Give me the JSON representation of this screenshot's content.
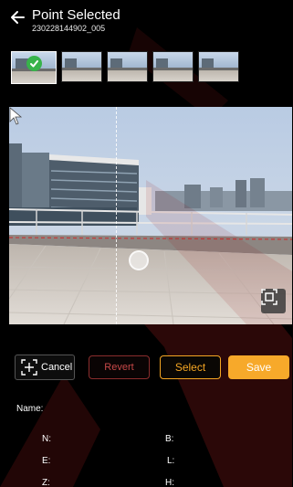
{
  "header": {
    "title": "Point Selected",
    "subtitle": "230228144902_005"
  },
  "thumbnails": [
    {
      "selected": true
    },
    {
      "selected": false
    },
    {
      "selected": false
    },
    {
      "selected": false
    },
    {
      "selected": false
    }
  ],
  "actions": {
    "cancel_label": "Cancel",
    "revert_label": "Revert",
    "select_label": "Select",
    "save_label": "Save"
  },
  "info": {
    "name_label": "Name:",
    "n_label": "N:",
    "e_label": "E:",
    "z_label": "Z:",
    "b_label": "B:",
    "l_label": "L:",
    "h_label": "H:"
  },
  "colors": {
    "accent": "#f7a92a",
    "revert": "#c74848",
    "check": "#37b34a",
    "watermark": "#b02020"
  },
  "icons": {
    "back": "arrow-left-icon",
    "check": "checkmark-icon",
    "cancel": "crosshair-frame-icon",
    "fit": "fit-frame-icon"
  }
}
